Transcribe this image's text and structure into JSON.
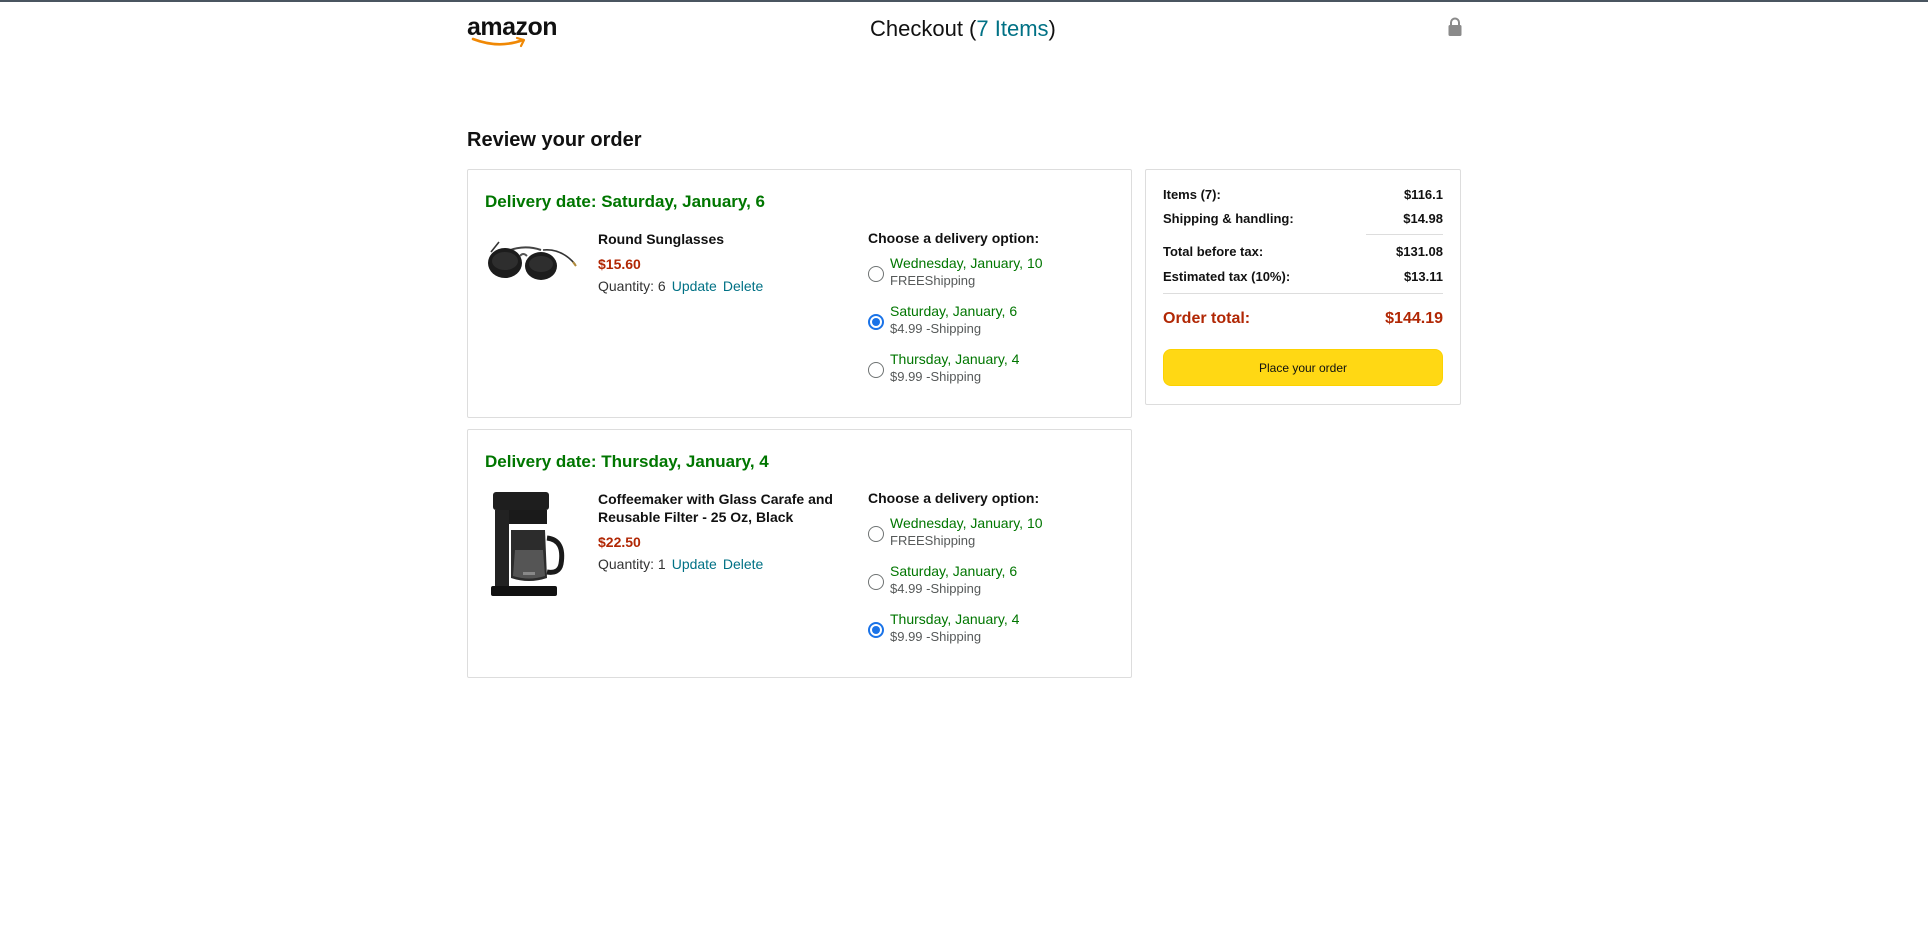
{
  "header": {
    "logo_text": "amazon",
    "checkout_prefix": "Checkout (",
    "checkout_count": "7 Items",
    "checkout_suffix": ")",
    "lock_icon": "lock-icon"
  },
  "page_heading": "Review your order",
  "shipments": [
    {
      "delivery_date": "Delivery date: Saturday, January, 6",
      "item": {
        "title": "Round Sunglasses",
        "price": "$15.60",
        "quantity_label": "Quantity: 6",
        "update_label": "Update",
        "delete_label": "Delete",
        "image_icon": "sunglasses-image"
      },
      "options_heading": "Choose a delivery option:",
      "options": [
        {
          "date": "Wednesday, January, 10",
          "shipping": "FREEShipping",
          "selected": false
        },
        {
          "date": "Saturday, January, 6",
          "shipping": "$4.99 -Shipping",
          "selected": true
        },
        {
          "date": "Thursday, January, 4",
          "shipping": "$9.99 -Shipping",
          "selected": false
        }
      ]
    },
    {
      "delivery_date": "Delivery date: Thursday, January, 4",
      "item": {
        "title": "Coffeemaker with Glass Carafe and Reusable Filter - 25 Oz, Black",
        "price": "$22.50",
        "quantity_label": "Quantity: 1",
        "update_label": "Update",
        "delete_label": "Delete",
        "image_icon": "coffeemaker-image"
      },
      "options_heading": "Choose a delivery option:",
      "options": [
        {
          "date": "Wednesday, January, 10",
          "shipping": "FREEShipping",
          "selected": false
        },
        {
          "date": "Saturday, January, 6",
          "shipping": "$4.99 -Shipping",
          "selected": false
        },
        {
          "date": "Thursday, January, 4",
          "shipping": "$9.99 -Shipping",
          "selected": true
        }
      ]
    }
  ],
  "summary": {
    "items_label": "Items (7):",
    "items_value": "$116.1",
    "shipping_label": "Shipping & handling:",
    "shipping_value": "$14.98",
    "before_tax_label": "Total before tax:",
    "before_tax_value": "$131.08",
    "tax_label": "Estimated tax (10%):",
    "tax_value": "$13.11",
    "total_label": "Order total:",
    "total_value": "$144.19",
    "place_order_label": "Place your order"
  },
  "colors": {
    "accent_link": "#007185",
    "delivery_green": "#007600",
    "price_red": "#b12704",
    "button_yellow": "#ffd814",
    "radio_blue": "#1a73e8"
  }
}
